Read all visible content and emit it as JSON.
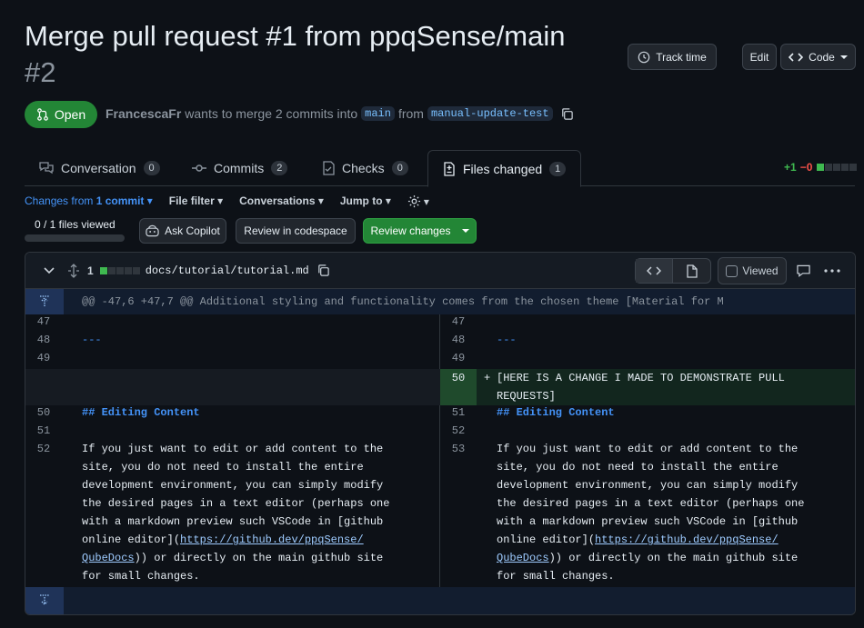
{
  "pr": {
    "title": "Merge pull request #1 from ppqSense/main",
    "number": "#2",
    "state": "Open",
    "author": "FrancescaFr",
    "merge_text": "wants to merge 2 commits into",
    "base_branch": "main",
    "from_text": "from",
    "head_branch": "manual-update-test"
  },
  "header_buttons": {
    "track_time": "Track time",
    "edit": "Edit",
    "code": "Code"
  },
  "tabs": [
    {
      "label": "Conversation",
      "count": "0"
    },
    {
      "label": "Commits",
      "count": "2"
    },
    {
      "label": "Checks",
      "count": "0"
    },
    {
      "label": "Files changed",
      "count": "1"
    }
  ],
  "diffstat": {
    "additions": "+1",
    "deletions": "−0"
  },
  "toolbar": {
    "changes_prefix": "Changes from",
    "changes_value": "1 commit",
    "file_filter": "File filter",
    "conversations": "Conversations",
    "jump_to": "Jump to"
  },
  "files_viewed": "0 / 1 files viewed",
  "actions": {
    "ask_copilot": "Ask Copilot",
    "review_codespace": "Review in codespace",
    "review_changes": "Review changes"
  },
  "file": {
    "change_count": "1",
    "path": "docs/tutorial/tutorial.md",
    "viewed_label": "Viewed",
    "hunk_header": "@@ -47,6 +47,7 @@ Additional styling and functionality comes from the chosen theme [Material for M"
  },
  "diff": {
    "left": {
      "l47": "47",
      "l48": "48",
      "l49": "49",
      "l50": "50",
      "l51": "51",
      "l52": "52",
      "hr": "---",
      "heading": "## Editing Content",
      "para1": "If you just want to edit or add content to the",
      "para2": "site, you do not need to install the entire",
      "para3": "development environment, you can simply modify",
      "para4": "the desired pages in a text editor (perhaps one",
      "para5": "with a markdown preview such VSCode in [github",
      "para6_pre": "online editor](",
      "para6_link": "https://github.dev/ppqSense/",
      "para7_link": "QubeDocs",
      "para7_post": ")) or directly on the main github site",
      "para8": "for small changes."
    },
    "right": {
      "l47": "47",
      "l48": "48",
      "l49": "49",
      "l50": "50",
      "l51": "51",
      "l52": "52",
      "l53": "53",
      "hr": "---",
      "add_marker": "+",
      "added1": "[HERE IS A CHANGE I MADE TO DEMONSTRATE PULL",
      "added2": "REQUESTS]",
      "heading": "## Editing Content",
      "para1": "If you just want to edit or add content to the",
      "para2": "site, you do not need to install the entire",
      "para3": "development environment, you can simply modify",
      "para4": "the desired pages in a text editor (perhaps one",
      "para5": "with a markdown preview such VSCode in [github",
      "para6_pre": "online editor](",
      "para6_link": "https://github.dev/ppqSense/",
      "para7_link": "QubeDocs",
      "para7_post": ")) or directly on the main github site",
      "para8": "for small changes."
    }
  },
  "colors": {
    "open_green": "#238636",
    "addition_green": "#3fb950",
    "deletion_red": "#f85149",
    "link_blue": "#4493f8"
  }
}
